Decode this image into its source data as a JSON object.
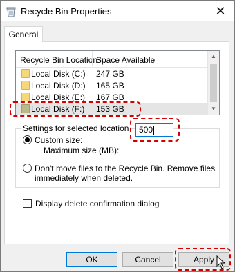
{
  "window": {
    "title": "Recycle Bin Properties",
    "close_glyph": "✕"
  },
  "tabs": [
    {
      "label": "General"
    }
  ],
  "list": {
    "headers": {
      "location": "Recycle Bin Location",
      "space": "Space Available"
    },
    "rows": [
      {
        "name": "Local Disk (C:)",
        "space": "247 GB"
      },
      {
        "name": "Local Disk (D:)",
        "space": "165 GB"
      },
      {
        "name": "Local Disk (E:)",
        "space": "167 GB"
      },
      {
        "name": "Local Disk (F:)",
        "space": "153 GB",
        "selected": true
      }
    ]
  },
  "settings": {
    "legend": "Settings for selected location",
    "custom_size_label": "Custom size:",
    "max_size_label": "Maximum size (MB):",
    "max_size_value": "500",
    "dont_move_line1": "Don't move files to the Recycle Bin. Remove files",
    "dont_move_line2": "immediately when deleted."
  },
  "confirm_label": "Display delete confirmation dialog",
  "buttons": {
    "ok": "OK",
    "cancel": "Cancel",
    "apply": "Apply"
  },
  "colors": {
    "highlight": "#d40000",
    "accent": "#0078d7",
    "folder": "#f7d77b"
  },
  "icons": [
    "recycle-bin-icon",
    "close-icon",
    "folder-icon",
    "arrow-cursor-icon"
  ]
}
